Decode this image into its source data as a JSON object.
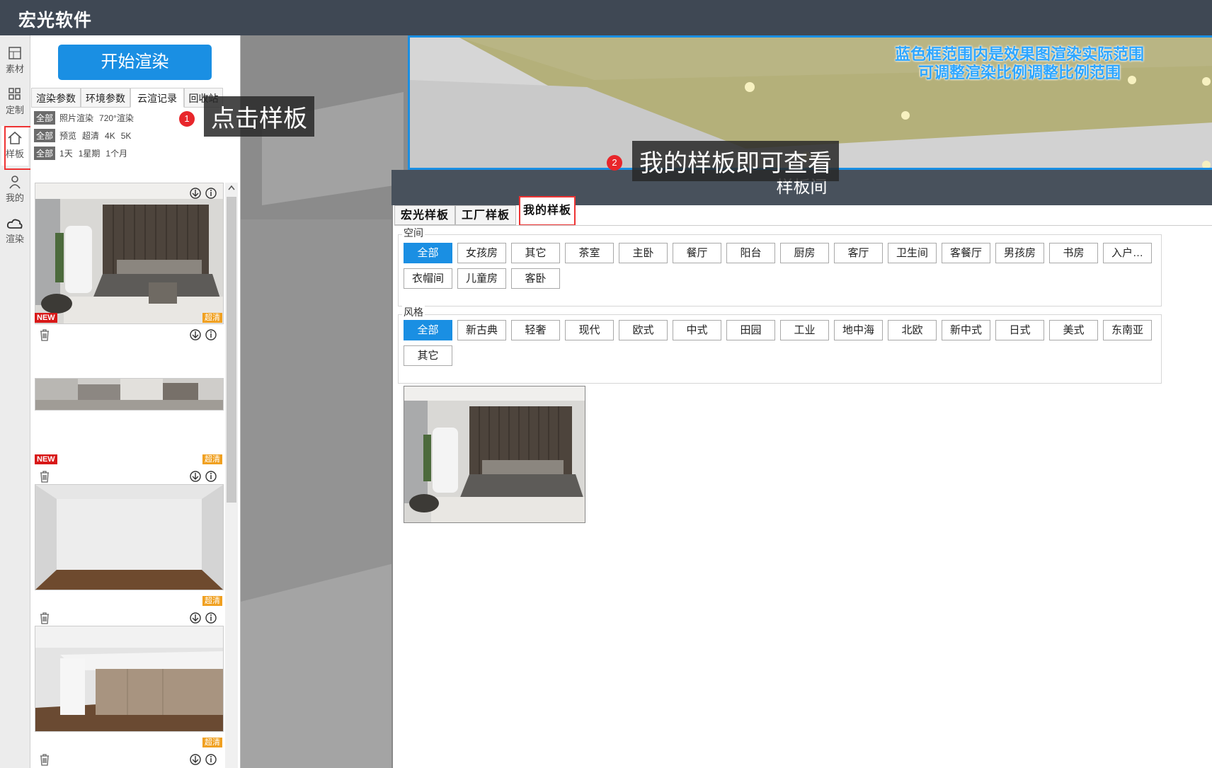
{
  "app_title": "宏光软件",
  "rail": [
    {
      "icon": "grid-icon",
      "label": "素材"
    },
    {
      "icon": "apps-icon",
      "label": "定制"
    },
    {
      "icon": "home-icon",
      "label": "样板"
    },
    {
      "icon": "user-icon",
      "label": "我的"
    },
    {
      "icon": "cloud-render-icon",
      "label": "渲染"
    }
  ],
  "panel": {
    "start_render": "开始渲染",
    "tabs": [
      "渲染参数",
      "环境参数",
      "云渲记录",
      "回收站"
    ],
    "filters": [
      [
        "全部",
        "照片渲染",
        "720°渲染"
      ],
      [
        "全部",
        "预览",
        "超清",
        "4K",
        "5K"
      ],
      [
        "全部",
        "1天",
        "1星期",
        "1个月"
      ]
    ],
    "badge_new": "NEW",
    "badge_hd": "超清"
  },
  "viewport": {
    "frame_note_line1": "蓝色框范围内是效果图渲染实际范围",
    "frame_note_line2": "可调整渲染比例调整比例范围"
  },
  "callouts": {
    "step1_num": "1",
    "step1_text": "点击样板",
    "step2_num": "2",
    "step2_text": "我的样板即可查看"
  },
  "dialog": {
    "title": "样板间",
    "tabs": [
      "宏光样板",
      "工厂样板",
      "我的样板"
    ],
    "space_label": "空间",
    "space_chips": [
      "全部",
      "女孩房",
      "其它",
      "茶室",
      "主卧",
      "餐厅",
      "阳台",
      "厨房",
      "客厅",
      "卫生间",
      "客餐厅",
      "男孩房",
      "书房",
      "入户…",
      "衣帽间",
      "儿童房",
      "客卧"
    ],
    "style_label": "风格",
    "style_chips": [
      "全部",
      "新古典",
      "轻奢",
      "现代",
      "欧式",
      "中式",
      "田园",
      "工业",
      "地中海",
      "北欧",
      "新中式",
      "日式",
      "美式",
      "东南亚",
      "其它"
    ]
  },
  "colors": {
    "topbar": "#3f4854",
    "accent": "#1a8fe3",
    "highlight": "#e33333",
    "dialog_header": "#48515c"
  }
}
